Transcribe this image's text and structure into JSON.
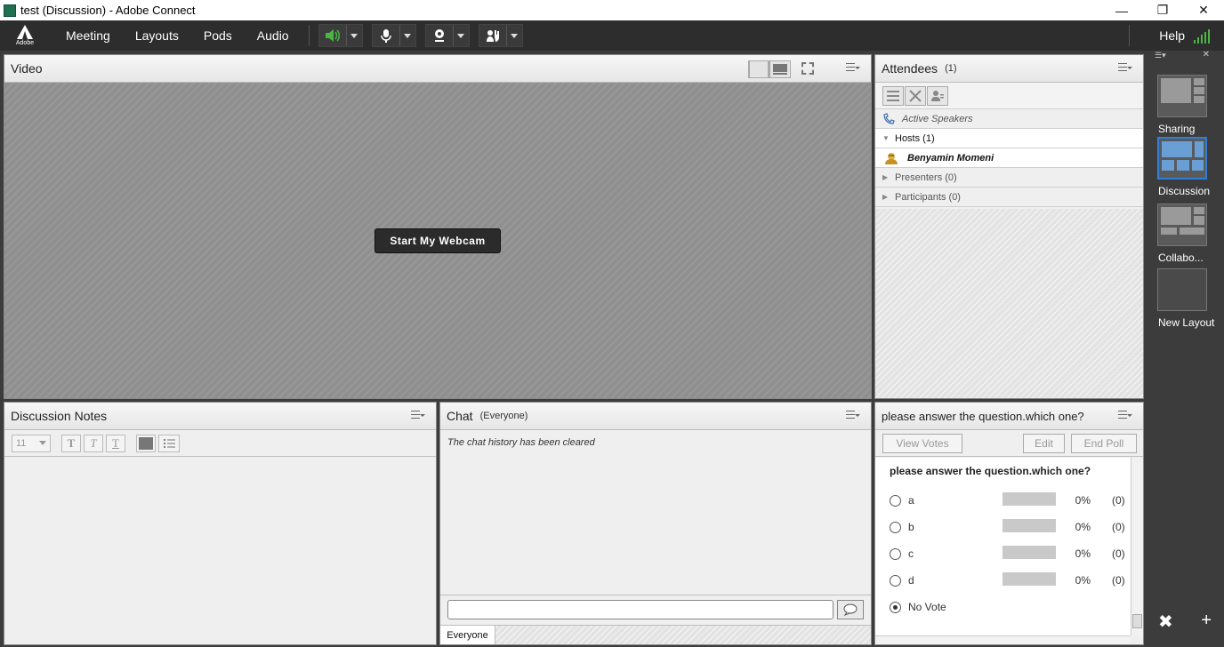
{
  "window": {
    "title": "test (Discussion) - Adobe Connect"
  },
  "menubar": {
    "logo_label": "Adobe",
    "items": [
      "Meeting",
      "Layouts",
      "Pods",
      "Audio"
    ],
    "help": "Help"
  },
  "video_pod": {
    "title": "Video",
    "webcam_button": "Start My Webcam"
  },
  "attendees_pod": {
    "title": "Attendees",
    "count": "(1)",
    "active_speakers": "Active Speakers",
    "hosts": "Hosts (1)",
    "host_name": "Benyamin Momeni",
    "presenters": "Presenters (0)",
    "participants": "Participants (0)"
  },
  "notes_pod": {
    "title": "Discussion Notes",
    "font_size": "11"
  },
  "chat_pod": {
    "title": "Chat",
    "scope": "(Everyone)",
    "message": "The chat history has been cleared",
    "tab": "Everyone"
  },
  "poll_pod": {
    "title": "please answer the question.which one?",
    "view_votes": "View Votes",
    "edit": "Edit",
    "end_poll": "End Poll",
    "question": "please answer the question.which one?",
    "options": [
      {
        "label": "a",
        "percent": "0%",
        "count": "(0)"
      },
      {
        "label": "b",
        "percent": "0%",
        "count": "(0)"
      },
      {
        "label": "c",
        "percent": "0%",
        "count": "(0)"
      },
      {
        "label": "d",
        "percent": "0%",
        "count": "(0)"
      }
    ],
    "no_vote": "No Vote"
  },
  "layouts": {
    "items": [
      "Sharing",
      "Discussion",
      "Collabo...",
      "New Layout"
    ],
    "selected": "Discussion"
  },
  "colors": {
    "menubar": "#2d2d2d",
    "accent_selected": "#2f7fd6",
    "audio_active": "#4bb543"
  }
}
